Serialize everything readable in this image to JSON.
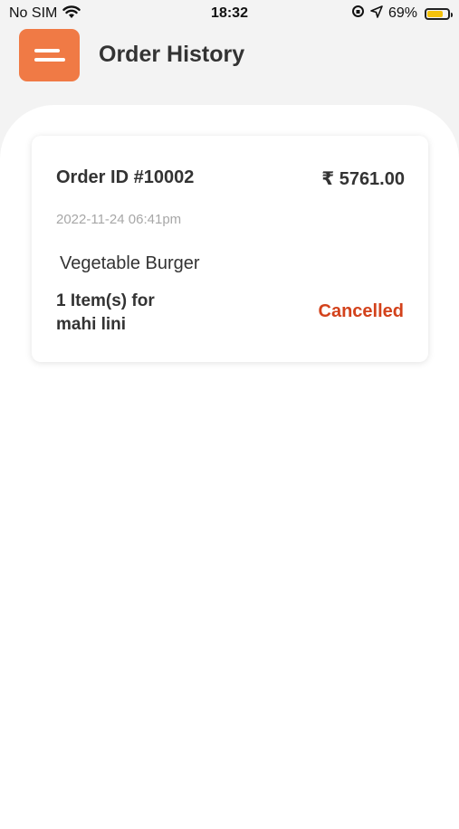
{
  "status_bar": {
    "carrier": "No SIM",
    "time": "18:32",
    "battery_percent": "69%",
    "battery_level": 0.69,
    "wifi_icon": "wifi-icon",
    "lock_icon": "orientation-lock-icon",
    "location_icon": "location-arrow-icon"
  },
  "header": {
    "title": "Order History",
    "menu_icon": "menu-icon",
    "accent_color": "#f07a45"
  },
  "orders": [
    {
      "order_id": "Order ID #10002",
      "amount": "₹ 5761.00",
      "date": "2022-11-24 06:41pm",
      "item_name": "Vegetable Burger",
      "items_line": "1 Item(s) for",
      "customer": "mahi lini",
      "status": "Cancelled",
      "status_color": "#d3421b"
    }
  ]
}
